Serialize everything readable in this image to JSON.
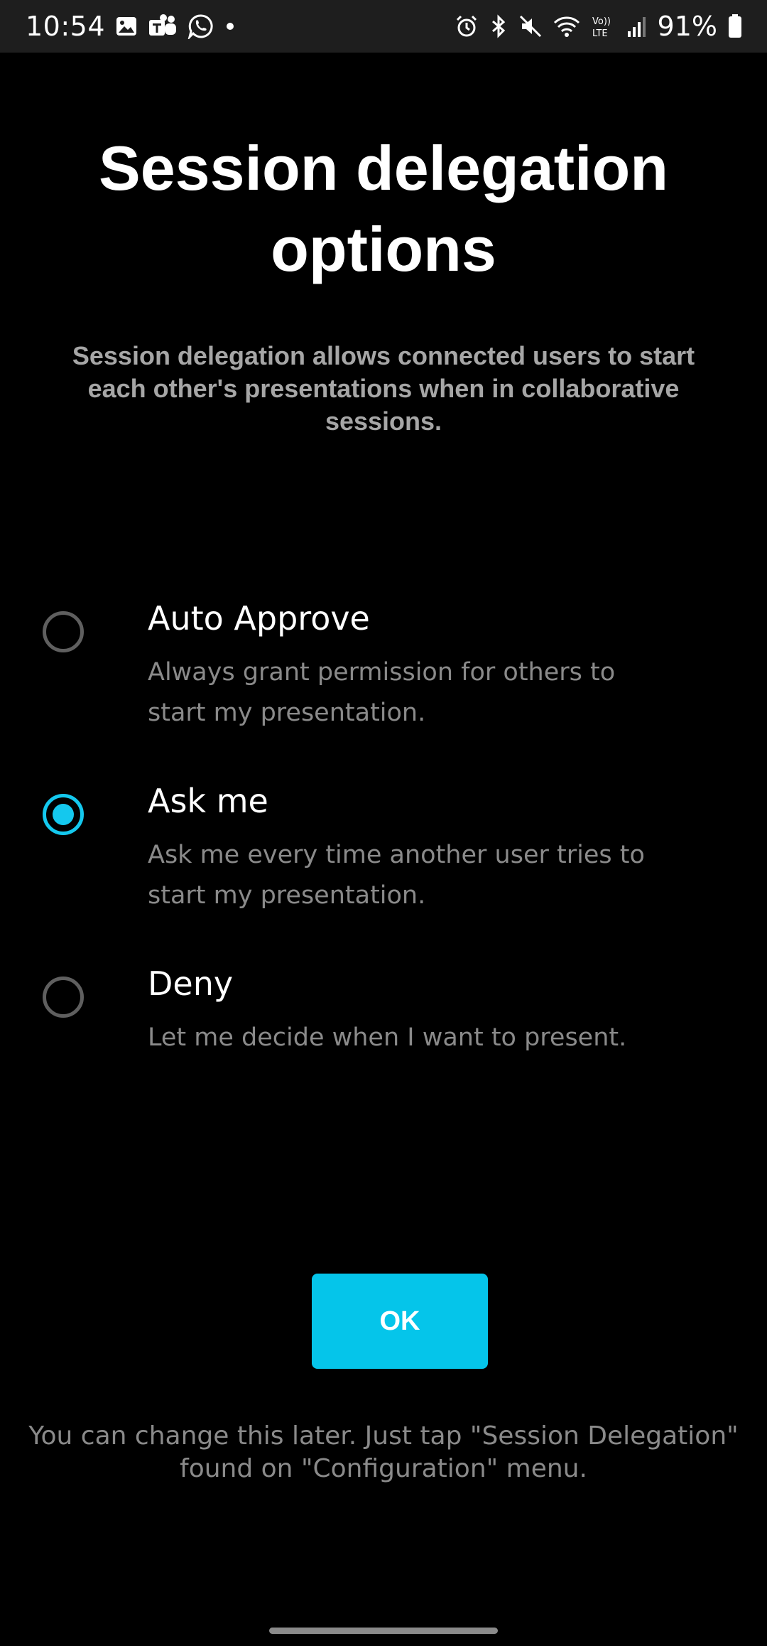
{
  "status_bar": {
    "time": "10:54",
    "left_icons": [
      "gallery-icon",
      "teams-icon",
      "whatsapp-icon",
      "notification-dot-icon"
    ],
    "right_icons": [
      "alarm-icon",
      "bluetooth-icon",
      "mute-icon",
      "wifi-icon",
      "volte-icon",
      "signal-icon"
    ],
    "volte_label": "Vo)) LTE",
    "battery_percent": "91%"
  },
  "page": {
    "title": "Session delegation options",
    "subtitle": "Session delegation allows connected users to start each other's presentations when in collaborative sessions."
  },
  "options": [
    {
      "title": "Auto Approve",
      "description": "Always grant permission for others to start my presentation.",
      "selected": false
    },
    {
      "title": "Ask me",
      "description": "Ask me every time another user tries to start my presentation.",
      "selected": true
    },
    {
      "title": "Deny",
      "description": "Let me decide when I want to present.",
      "selected": false
    }
  ],
  "ok_button": {
    "label": "OK"
  },
  "footer": {
    "note": "You can change this later. Just tap \"Session Delegation\" found on \"Configuration\" menu."
  },
  "colors": {
    "accent": "#05c5ea",
    "radio_selected": "#14c8ee",
    "radio_unselected": "#5f5f5f",
    "background": "#000000",
    "status_bar_bg": "#1e1e1e",
    "secondary_text": "#8a8a8a"
  }
}
